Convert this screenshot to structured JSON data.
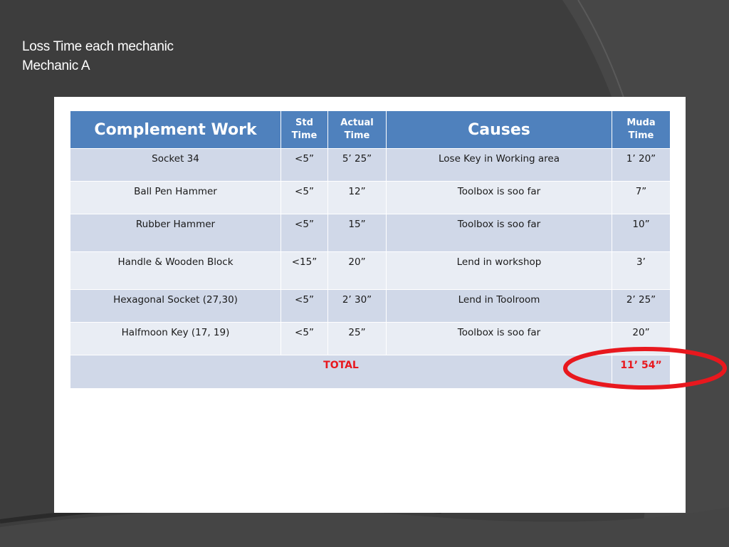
{
  "slide": {
    "title_line1": "Loss Time each mechanic",
    "title_line2": "Mechanic A"
  },
  "table": {
    "headers": {
      "work": "Complement Work",
      "std_line1": "Std",
      "std_line2": "Time",
      "actual_line1": "Actual",
      "actual_line2": "Time",
      "causes": "Causes",
      "muda_line1": "Muda",
      "muda_line2": "Time"
    },
    "rows": [
      {
        "work": "Socket 34",
        "std": "<5”",
        "actual": "5’ 25”",
        "cause": "Lose Key in Working area",
        "muda": "1’ 20”"
      },
      {
        "work": "Ball Pen Hammer",
        "std": "<5”",
        "actual": "12”",
        "cause": "Toolbox is soo far",
        "muda": "7”"
      },
      {
        "work": "Rubber Hammer",
        "std": "<5”",
        "actual": "15”",
        "cause": "Toolbox is soo far",
        "muda": "10”"
      },
      {
        "work": "Handle & Wooden Block",
        "std": "<15”",
        "actual": "20”",
        "cause": "Lend in workshop",
        "muda": "3’"
      },
      {
        "work": "Hexagonal Socket (27,30)",
        "std": "<5”",
        "actual": "2’ 30”",
        "cause": "Lend in Toolroom",
        "muda": "2’ 25”"
      },
      {
        "work": "Halfmoon Key (17, 19)",
        "std": "<5”",
        "actual": "25”",
        "cause": "Toolbox is soo far",
        "muda": "20”"
      }
    ],
    "total_label": "TOTAL",
    "total_value": "11’ 54”"
  },
  "colors": {
    "background": "#3d3d3d",
    "header_blue": "#4f81bd",
    "row_dark": "#d0d8e8",
    "row_light": "#e9edf4",
    "highlight_red": "#e8181e"
  }
}
